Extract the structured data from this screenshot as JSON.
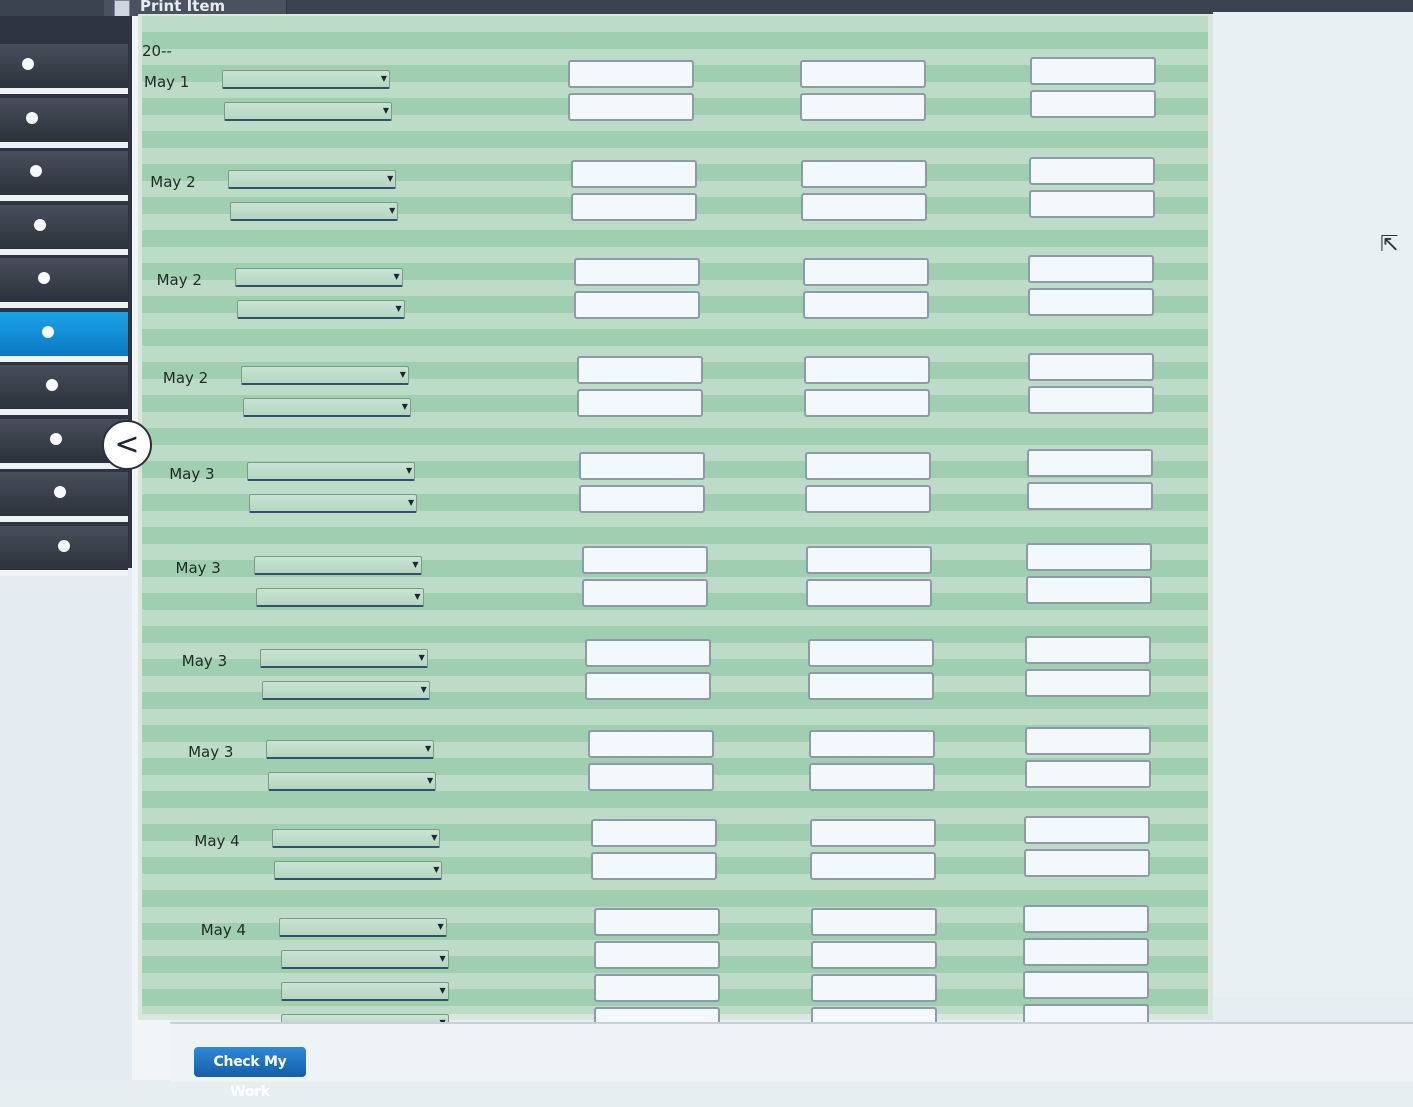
{
  "header": {
    "print_label": "Print Item",
    "print_icon": "printer-doc-icon"
  },
  "nav": {
    "steps": 10,
    "active_step": 6,
    "collapse_icon": "chevron-left-icon",
    "collapse_glyph": "<"
  },
  "journal": {
    "year": "20--",
    "entries": [
      {
        "date": "May 1"
      },
      {
        "date": "May 2"
      },
      {
        "date": "May 2"
      },
      {
        "date": "May 2"
      },
      {
        "date": "May 3"
      },
      {
        "date": "May 3"
      },
      {
        "date": "May 3"
      },
      {
        "date": "May 3"
      },
      {
        "date": "May 4"
      },
      {
        "date": "May 4"
      }
    ]
  },
  "footer": {
    "check_label": "Check My Work"
  },
  "colors": {
    "row_light": "#bcdcc8",
    "row_dark": "#9fcfb0",
    "nav_active": "#1aa4e8",
    "button": "#135ea8"
  }
}
